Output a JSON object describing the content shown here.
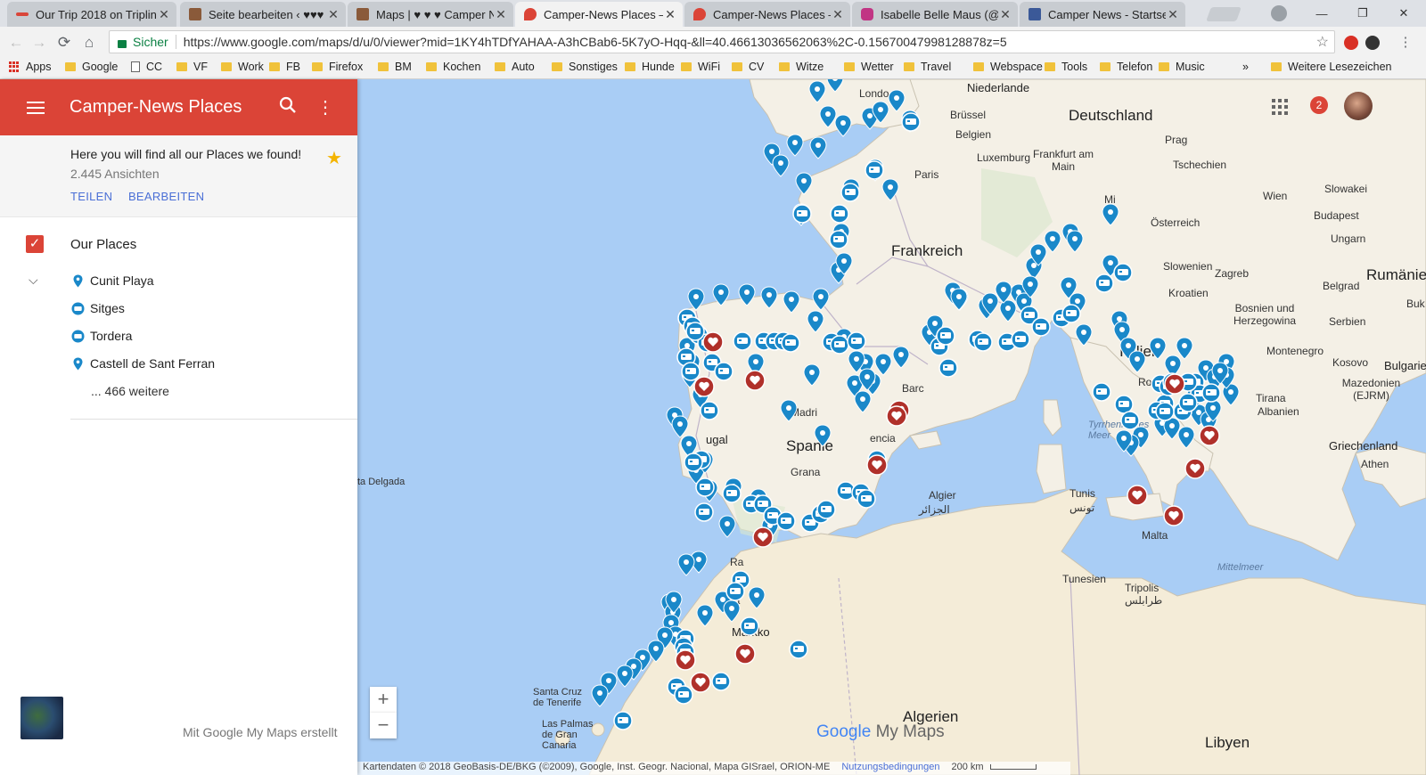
{
  "browser": {
    "tabs": [
      {
        "title": "Our Trip 2018 on Tripline",
        "color": "#d9463a",
        "active": false
      },
      {
        "title": "Seite bearbeiten ‹ ♥♥♥ ",
        "color": "#8a5a3a",
        "active": false
      },
      {
        "title": "Maps | ♥ ♥ ♥ Camper Ne",
        "color": "#8a5a3a",
        "active": false
      },
      {
        "title": "Camper-News Places – G",
        "color": "#db4437",
        "active": true
      },
      {
        "title": "Camper-News Places – G",
        "color": "#db4437",
        "active": false
      },
      {
        "title": "Isabelle Belle Maus (@ca",
        "color": "#c13584",
        "active": false
      },
      {
        "title": "Camper News - Startseit",
        "color": "#3b5998",
        "active": false
      }
    ],
    "secure_label": "Sicher",
    "url": "https://www.google.com/maps/d/u/0/viewer?mid=1KY4hTDfYAHAA-A3hCBab6-5K7yO-Hqq-&ll=40.46613036562063%2C-0.15670047998128878z=5",
    "bookmarks": [
      {
        "label": "Apps",
        "type": "apps"
      },
      {
        "label": "Google",
        "type": "folder"
      },
      {
        "label": "CC",
        "type": "page"
      },
      {
        "label": "VF",
        "type": "folder"
      },
      {
        "label": "Work",
        "type": "folder"
      },
      {
        "label": "FB",
        "type": "folder"
      },
      {
        "label": "Firefox",
        "type": "folder"
      },
      {
        "label": "BM",
        "type": "folder"
      },
      {
        "label": "Kochen",
        "type": "folder"
      },
      {
        "label": "Auto",
        "type": "folder"
      },
      {
        "label": "Sonstiges",
        "type": "folder"
      },
      {
        "label": "Hunde",
        "type": "folder"
      },
      {
        "label": "WiFi",
        "type": "folder"
      },
      {
        "label": "CV",
        "type": "folder"
      },
      {
        "label": "Witze",
        "type": "folder"
      },
      {
        "label": "Wetter",
        "type": "folder"
      },
      {
        "label": "Travel",
        "type": "folder"
      },
      {
        "label": "Webspace",
        "type": "folder"
      },
      {
        "label": "Tools",
        "type": "folder"
      },
      {
        "label": "Telefon",
        "type": "folder"
      },
      {
        "label": "Music",
        "type": "folder"
      }
    ],
    "more_bookmarks": "»",
    "other_bookmarks": "Weitere Lesezeichen"
  },
  "panel": {
    "title": "Camper-News Places",
    "description": "Here you will find all our Places we found!",
    "views": "2.445 Ansichten",
    "share": "TEILEN",
    "edit": "BEARBEITEN",
    "layer": "Our Places",
    "places": [
      {
        "name": "Cunit Playa",
        "icon": "map-pin-icon"
      },
      {
        "name": "Sitges",
        "icon": "camper-icon"
      },
      {
        "name": "Tordera",
        "icon": "camper-icon"
      },
      {
        "name": "Castell de Sant Ferran",
        "icon": "map-pin-icon"
      }
    ],
    "more": "... 466 weitere",
    "made_with": "Mit Google My Maps erstellt"
  },
  "map": {
    "notification_count": "2",
    "zoom_in": "+",
    "zoom_out": "−",
    "brand_google": "Google",
    "brand_mymaps": "My Maps",
    "attribution": "Kartendaten © 2018 GeoBasis-DE/BKG (©2009), Google, Inst. Geogr. Nacional, Mapa GISrael, ORION-ME",
    "terms": "Nutzungsbedingungen",
    "scale": "200 km",
    "labels": {
      "niederlande": "Niederlande",
      "london": "Londo",
      "brussel": "Brüssel",
      "belgien": "Belgien",
      "deutschland": "Deutschland",
      "luxemburg": "Luxemburg",
      "frankfurt": "Frankfurt am Main",
      "prag": "Prag",
      "tschechien": "Tschechien",
      "paris": "Paris",
      "slowakei": "Slowakei",
      "wien": "Wien",
      "oesterreich": "Österreich",
      "budapest": "Budapest",
      "ungarn": "Ungarn",
      "mi": "Mi",
      "frankreich": "Frankreich",
      "slowenien": "Slowenien",
      "zagreb": "Zagreb",
      "kroatien": "Kroatien",
      "rumaenien": "Rumänien",
      "belgrad": "Belgrad",
      "bosnien": "Bosnien und Herzegowina",
      "serbien": "Serbien",
      "buk": "Buk",
      "italien": "Italien",
      "montenegro": "Montenegro",
      "kosovo": "Kosovo",
      "bulgarien": "Bulgarie",
      "rom": "Rom",
      "mazedonien": "Mazedonien (EJRM)",
      "tirana": "Tirana",
      "albanien": "Albanien",
      "tyrrhenisches": "Tyrrhenisches Meer",
      "griechenland": "Griechenland",
      "athen": "Athen",
      "madrid": "Madri",
      "spanien": "Spanie",
      "portugal": "ugal",
      "barcelona": "Barc",
      "valencia": "encia",
      "granada": "Grana",
      "delgada": "ta Delgada",
      "algier": "Algier",
      "algier_ar": "الجزائر",
      "tunis": "Tunis",
      "tunis_ar": "تونس",
      "malta": "Malta",
      "mittelmeer": "Mittelmeer",
      "tunesien": "Tunesien",
      "tripolis": "Tripolis",
      "tripolis_ar": "طرابلس",
      "marokko": "Markko",
      "rabat": "Ra",
      "casa": "Ca",
      "santacruz": "Santa Cruz de Tenerife",
      "laspalmas": "Las Palmas de Gran Canaria",
      "algerien": "Algerien",
      "libyen": "Libyen"
    }
  }
}
